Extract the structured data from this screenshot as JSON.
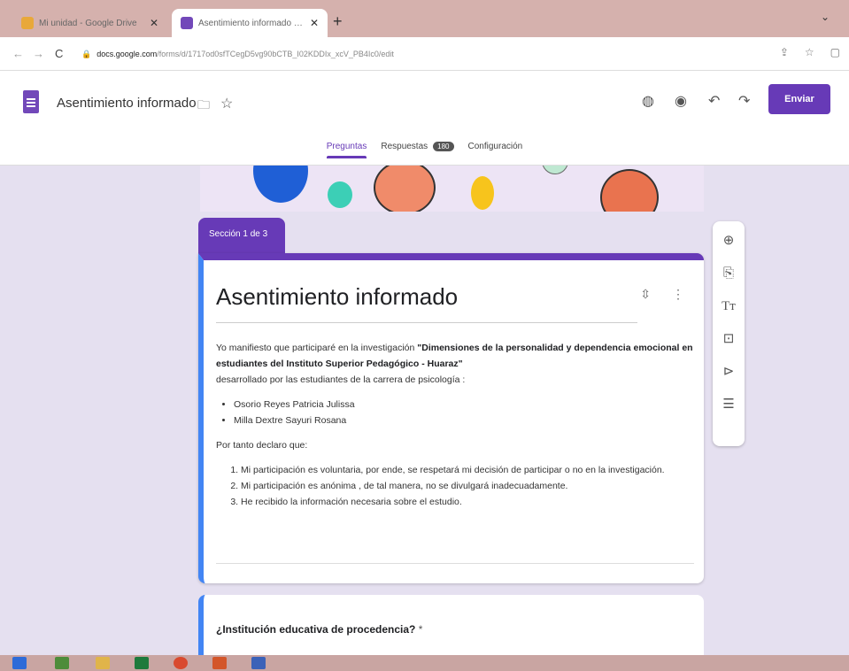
{
  "browser": {
    "tabs": [
      {
        "title": "Mi unidad - Google Drive",
        "active": false,
        "favicon_color": "#e8a83a"
      },
      {
        "title": "Asentimiento informado - Formularios de Google",
        "active": true,
        "favicon_color": "#7248b9"
      }
    ],
    "url_host": "docs.google.com",
    "url_path": "/forms/d/1717od0sfTCegD5vg90bCTB_I02KDDIx_xcV_PB4Ic0/edit"
  },
  "header": {
    "title": "Asentimiento informado",
    "send_label": "Enviar",
    "tabs": [
      {
        "label": "Preguntas",
        "active": true
      },
      {
        "label": "Respuestas",
        "badge": "180"
      },
      {
        "label": "Configuración"
      }
    ]
  },
  "section": {
    "label": "Sección 1 de 3",
    "title": "Asentimiento informado",
    "intro": "Yo manifiesto que participaré en la investigación ",
    "study_title": "\"Dimensiones de la personalidad y dependencia emocional en estudiantes del Instituto Superior Pedagógico - Huaraz\"",
    "developed_by": " desarrollado por las estudiantes  de la carrera de psicología :",
    "authors": [
      "Osorio Reyes Patricia Julissa",
      "Milla Dextre Sayuri Rosana"
    ],
    "declare": "Por tanto declaro que:",
    "statements": [
      "Mi participación es voluntaria, por ende, se respetará mi decisión de participar o no en la investigación.",
      "Mi participación es anónima , de tal manera, no se divulgará inadecuadamente.",
      "He recibido la información necesaria sobre el estudio."
    ]
  },
  "question": {
    "text": "¿Institución educativa de procedencia?",
    "required_mark": " *"
  },
  "colors": {
    "accent": "#673ab7",
    "focus_bar": "#4285f4",
    "background": "#e5e0f0"
  }
}
